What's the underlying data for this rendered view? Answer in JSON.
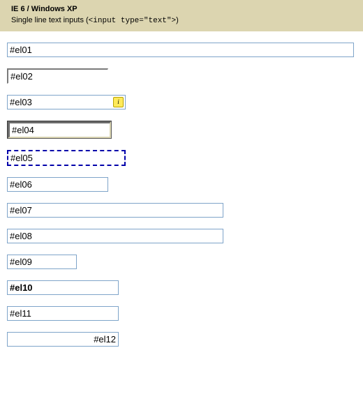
{
  "header": {
    "title": "IE 6 / Windows XP",
    "subtitle_prefix": "Single line text inputs (",
    "subtitle_code": "<input type=\"text\">",
    "subtitle_suffix": ")"
  },
  "inputs": {
    "el01": "#el01",
    "el02": "#el02",
    "el03": "#el03",
    "el03_icon": "i",
    "el04": "#el04",
    "el05": "#el05",
    "el06": "#el06",
    "el07": "#el07",
    "el08": "#el08",
    "el09": "#el09",
    "el10": "#el10",
    "el11": "#el11",
    "el12": "#el12"
  }
}
